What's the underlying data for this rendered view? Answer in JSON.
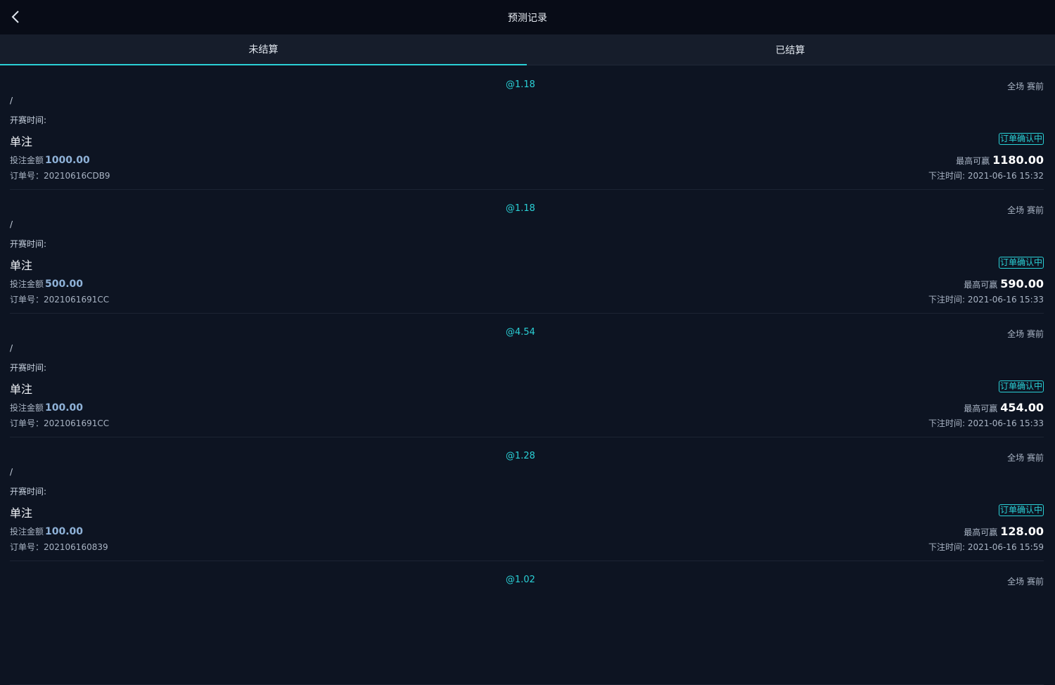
{
  "header": {
    "title": "预测记录",
    "back_icon": "chevron-left-icon"
  },
  "tabs": [
    {
      "label": "未结算",
      "active": true
    },
    {
      "label": "已结算",
      "active": false
    }
  ],
  "colors": {
    "accent": "#2ad0d6",
    "background": "#0d1422",
    "header_bg": "#080c17",
    "tab_bg": "#161d2b"
  },
  "orders": [
    {
      "odds": "@1.18",
      "tags": "全场 赛前",
      "match": "/",
      "start_time_label": "开赛时间:",
      "bet_type": "单注",
      "status": "订单确认中",
      "stake_label": "投注金额",
      "stake": "1000.00",
      "order_no": "订单号：20210616CDB9",
      "max_win_label": "最高可赢",
      "max_win": "1180.00",
      "place_time": "下注时间: 2021-06-16 15:32"
    },
    {
      "odds": "@1.18",
      "tags": "全场 赛前",
      "match": "/",
      "start_time_label": "开赛时间:",
      "bet_type": "单注",
      "status": "订单确认中",
      "stake_label": "投注金额",
      "stake": "500.00",
      "order_no": "订单号：2021061691CC",
      "max_win_label": "最高可赢",
      "max_win": "590.00",
      "place_time": "下注时间: 2021-06-16 15:33"
    },
    {
      "odds": "@4.54",
      "tags": "全场 赛前",
      "match": "/",
      "start_time_label": "开赛时间:",
      "bet_type": "单注",
      "status": "订单确认中",
      "stake_label": "投注金额",
      "stake": "100.00",
      "order_no": "订单号：2021061691CC",
      "max_win_label": "最高可赢",
      "max_win": "454.00",
      "place_time": "下注时间: 2021-06-16 15:33"
    },
    {
      "odds": "@1.28",
      "tags": "全场 赛前",
      "match": "/",
      "start_time_label": "开赛时间:",
      "bet_type": "单注",
      "status": "订单确认中",
      "stake_label": "投注金额",
      "stake": "100.00",
      "order_no": "订单号：202106160839",
      "max_win_label": "最高可赢",
      "max_win": "128.00",
      "place_time": "下注时间: 2021-06-16 15:59"
    },
    {
      "odds": "@1.02",
      "tags": "全场 赛前"
    }
  ]
}
